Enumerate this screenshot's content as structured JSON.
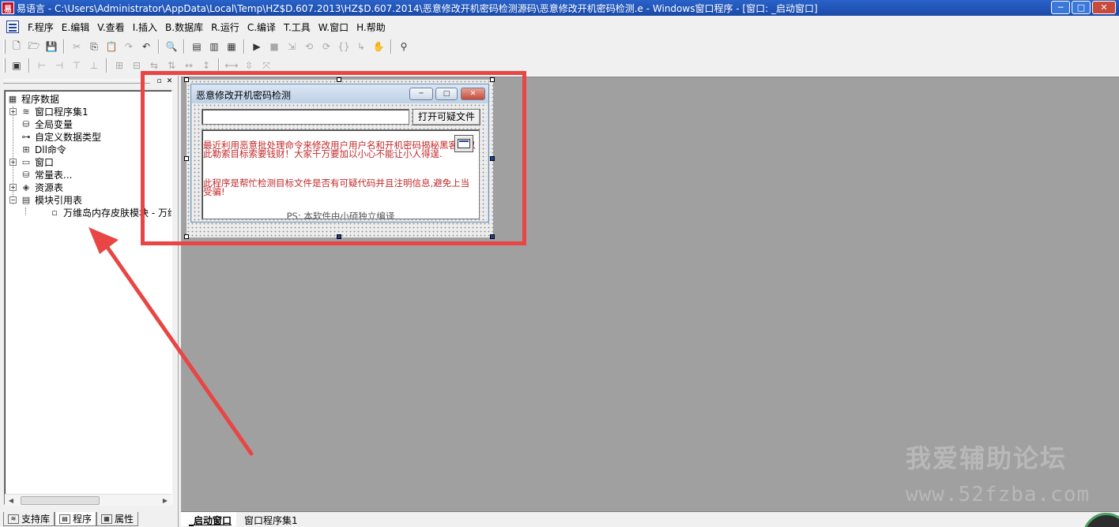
{
  "window": {
    "app_icon_glyph": "易",
    "title": "易语言 - C:\\Users\\Administrator\\AppData\\Local\\Temp\\HZ$D.607.2013\\HZ$D.607.2014\\恶意修改开机密码检测源码\\恶意修改开机密码检测.e - Windows窗口程序 - [窗口: _启动窗口]",
    "min_glyph": "─",
    "max_glyph": "□",
    "close_glyph": "✕"
  },
  "menu": {
    "items": [
      "F.程序",
      "E.编辑",
      "V.查看",
      "I.插入",
      "B.数据库",
      "R.运行",
      "C.编译",
      "T.工具",
      "W.窗口",
      "H.帮助"
    ]
  },
  "toolbar1": {
    "icons": [
      {
        "name": "new-file-icon",
        "glyph": "🗋",
        "dim": false
      },
      {
        "name": "open-folder-icon",
        "glyph": "🗁",
        "dim": false
      },
      {
        "name": "save-icon",
        "glyph": "💾",
        "dim": false
      },
      {
        "sep": true
      },
      {
        "name": "cut-icon",
        "glyph": "✂",
        "dim": true
      },
      {
        "name": "copy-icon",
        "glyph": "⎘",
        "dim": false
      },
      {
        "name": "paste-icon",
        "glyph": "📋",
        "dim": true
      },
      {
        "name": "redo-icon",
        "glyph": "↷",
        "dim": true
      },
      {
        "name": "undo-icon",
        "glyph": "↶",
        "dim": false
      },
      {
        "sep": true
      },
      {
        "name": "find-icon",
        "glyph": "🔍",
        "dim": false
      },
      {
        "sep": true
      },
      {
        "name": "layout-left-icon",
        "glyph": "▤",
        "dim": false
      },
      {
        "name": "layout-top-icon",
        "glyph": "▥",
        "dim": false
      },
      {
        "name": "layout-full-icon",
        "glyph": "▦",
        "dim": false
      },
      {
        "sep": true
      },
      {
        "name": "run-icon",
        "glyph": "▶",
        "dim": false
      },
      {
        "name": "stop-icon",
        "glyph": "■",
        "dim": true
      },
      {
        "name": "step-icon",
        "glyph": "⇲",
        "dim": true
      },
      {
        "name": "step-into-icon",
        "glyph": "⟲",
        "dim": true
      },
      {
        "name": "step-over-icon",
        "glyph": "⟳",
        "dim": true
      },
      {
        "name": "step-out-icon",
        "glyph": "{}",
        "dim": true
      },
      {
        "name": "run-to-icon",
        "glyph": "↳",
        "dim": true
      },
      {
        "name": "hand-icon",
        "glyph": "✋",
        "dim": true
      },
      {
        "sep": true
      },
      {
        "name": "binoculars-icon",
        "glyph": "⚲",
        "dim": false
      }
    ]
  },
  "toolbar2": {
    "icons": [
      {
        "name": "form-designer-icon",
        "glyph": "▣",
        "dim": false
      },
      {
        "sep": true
      },
      {
        "name": "align-left-icon",
        "glyph": "⊢",
        "dim": true
      },
      {
        "name": "align-center-icon",
        "glyph": "⊣",
        "dim": true
      },
      {
        "name": "align-top-icon",
        "glyph": "⊤",
        "dim": true
      },
      {
        "name": "align-bottom-icon",
        "glyph": "⊥",
        "dim": true
      },
      {
        "sep": true
      },
      {
        "name": "center-h-icon",
        "glyph": "⊞",
        "dim": true
      },
      {
        "name": "center-v-icon",
        "glyph": "⊟",
        "dim": true
      },
      {
        "name": "same-width-icon",
        "glyph": "⇆",
        "dim": true
      },
      {
        "name": "same-height-icon",
        "glyph": "⇅",
        "dim": true
      },
      {
        "name": "spacing-h-icon",
        "glyph": "↔",
        "dim": true
      },
      {
        "name": "spacing-v-icon",
        "glyph": "↕",
        "dim": true
      },
      {
        "sep": true
      },
      {
        "name": "size-h-icon",
        "glyph": "⟷",
        "dim": true
      },
      {
        "name": "size-v-icon",
        "glyph": "⇳",
        "dim": true
      },
      {
        "name": "size-both-icon",
        "glyph": "⤧",
        "dim": true
      }
    ]
  },
  "left_panel": {
    "pin_glyph": "▫",
    "close_glyph": "✕",
    "tree": [
      {
        "label": "程序数据",
        "icon": "▦",
        "expander": "",
        "level": 0
      },
      {
        "label": "窗口程序集1",
        "icon": "≋",
        "expander": "+",
        "level": 1
      },
      {
        "label": "全局变量",
        "icon": "⛁",
        "expander": "",
        "level": 1
      },
      {
        "label": "自定义数据类型",
        "icon": "⊶",
        "expander": "",
        "level": 1
      },
      {
        "label": "Dll命令",
        "icon": "⊞",
        "expander": "",
        "level": 1
      },
      {
        "label": "窗口",
        "icon": "▭",
        "expander": "+",
        "level": 1
      },
      {
        "label": "常量表...",
        "icon": "⛁",
        "expander": "",
        "level": 1
      },
      {
        "label": "资源表",
        "icon": "◈",
        "expander": "+",
        "level": 1
      },
      {
        "label": "模块引用表",
        "icon": "▤",
        "expander": "−",
        "level": 1
      },
      {
        "label": "万维岛内存皮肤模块 - 万维",
        "icon": "▫",
        "expander": "",
        "level": 2
      }
    ],
    "scroll_left": "◀",
    "scroll_right": "▶",
    "tabs": [
      {
        "label": "支持库",
        "icon": "≋"
      },
      {
        "label": "程序",
        "icon": "▤"
      },
      {
        "label": "属性",
        "icon": "▦"
      }
    ]
  },
  "form": {
    "title": "恶意修改开机密码检测",
    "min_glyph": "─",
    "max_glyph": "□",
    "close_glyph": "✕",
    "path_value": "",
    "open_button": "打开可疑文件",
    "info_para1": "  最近利用恶意批处理命令来修改用户用户名和开机密码揭秘黑客们以此勒索目标索要钱财！大家千万要加以小心不能让小人得逞.",
    "info_para2": "  此程序是帮忙检测目标文件是否有可疑代码并且注明信息,避免上当受骗!",
    "ps_note": "PS: 本软件由小硕独立编译"
  },
  "source_tabs": [
    {
      "label": "_启动窗口",
      "active": true
    },
    {
      "label": "窗口程序集1",
      "active": false
    }
  ],
  "watermark": {
    "line1": "我爱辅助论坛",
    "line2": "www.52fzba.com"
  },
  "colors": {
    "annotation_red": "#e84545",
    "info_text_red": "#c0282a",
    "design_gray": "#a0a0a0"
  }
}
